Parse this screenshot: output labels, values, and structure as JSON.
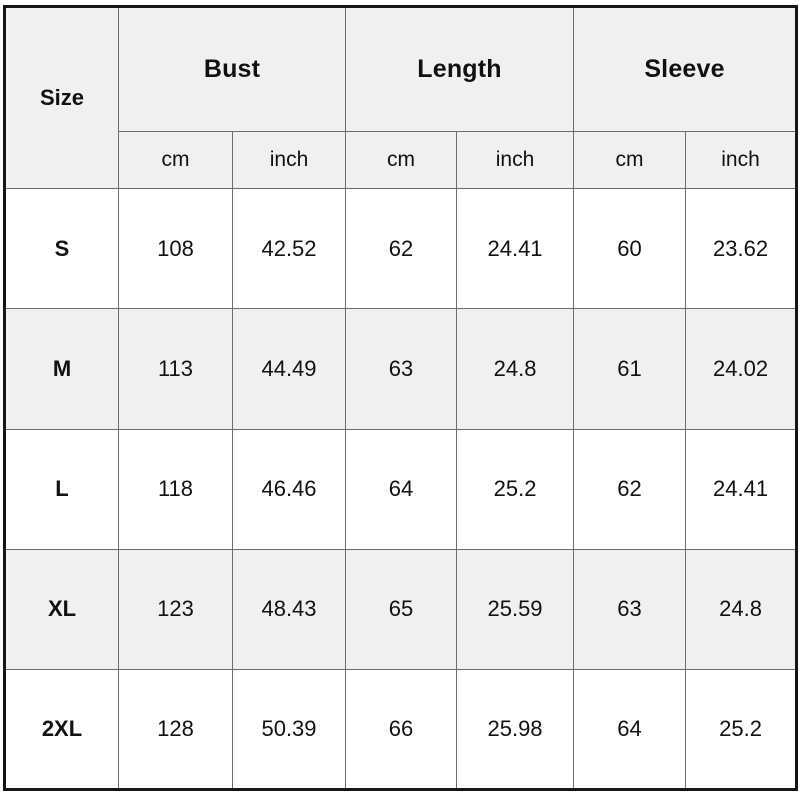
{
  "table": {
    "size_header": "Size",
    "groups": [
      {
        "label": "Bust"
      },
      {
        "label": "Length"
      },
      {
        "label": "Sleeve"
      }
    ],
    "units": [
      "cm",
      "inch",
      "cm",
      "inch",
      "cm",
      "inch"
    ],
    "rows": [
      {
        "size": "S",
        "shaded": false,
        "bust_cm": "108",
        "bust_inch": "42.52",
        "length_cm": "62",
        "length_inch": "24.41",
        "sleeve_cm": "60",
        "sleeve_inch": "23.62"
      },
      {
        "size": "M",
        "shaded": true,
        "bust_cm": "113",
        "bust_inch": "44.49",
        "length_cm": "63",
        "length_inch": "24.8",
        "sleeve_cm": "61",
        "sleeve_inch": "24.02"
      },
      {
        "size": "L",
        "shaded": false,
        "bust_cm": "118",
        "bust_inch": "46.46",
        "length_cm": "64",
        "length_inch": "25.2",
        "sleeve_cm": "62",
        "sleeve_inch": "24.41"
      },
      {
        "size": "XL",
        "shaded": true,
        "bust_cm": "123",
        "bust_inch": "48.43",
        "length_cm": "65",
        "length_inch": "25.59",
        "sleeve_cm": "63",
        "sleeve_inch": "24.8"
      },
      {
        "size": "2XL",
        "shaded": false,
        "bust_cm": "128",
        "bust_inch": "50.39",
        "length_cm": "66",
        "length_inch": "25.98",
        "sleeve_cm": "64",
        "sleeve_inch": "25.2"
      }
    ]
  },
  "colors": {
    "header_background": "#f0f0f0",
    "row_shaded_background": "#f0f0f0",
    "row_plain_background": "#ffffff",
    "outer_border": "#161616",
    "inner_border": "#6d6d6d",
    "text": "#111111"
  }
}
